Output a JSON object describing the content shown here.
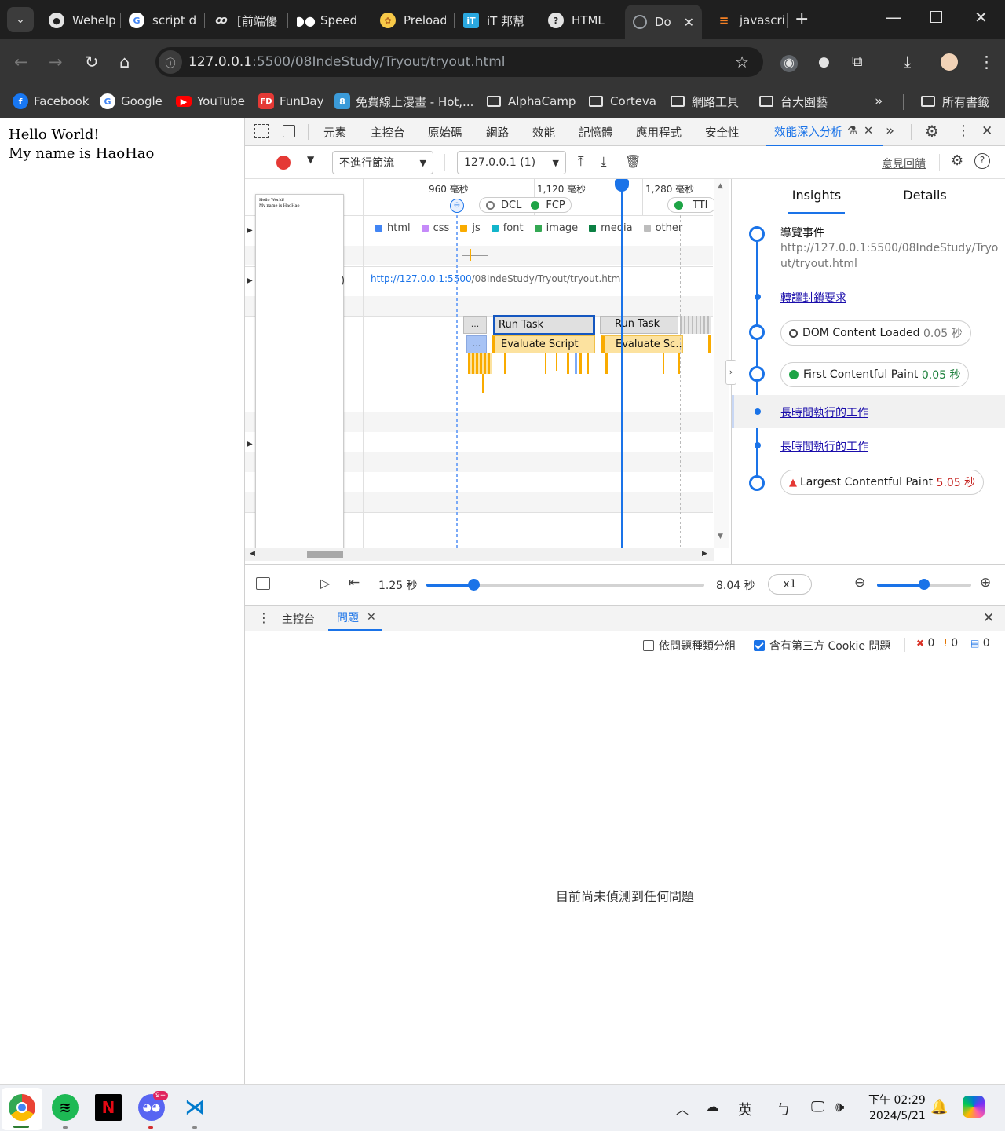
{
  "browser": {
    "tabs": [
      {
        "title": "Wehelp",
        "icon": "github-icon"
      },
      {
        "title": "script d",
        "icon": "google-icon"
      },
      {
        "title": "[前端優",
        "icon": "link-icon"
      },
      {
        "title": "Speed",
        "icon": "medium-icon"
      },
      {
        "title": "Preload",
        "icon": "preload-icon"
      },
      {
        "title": "iT 邦幫",
        "icon": "ithome-icon"
      },
      {
        "title": "HTML",
        "icon": "help-icon"
      },
      {
        "title": "Do",
        "icon": "globe-icon",
        "active": true
      },
      {
        "title": "javascri",
        "icon": "stackoverflow-icon"
      }
    ],
    "url_host": "127.0.0.1",
    "url_path": ":5500/08IndeStudy/Tryout/tryout.html",
    "bookmarks": [
      "Facebook",
      "Google",
      "YouTube",
      "FunDay",
      "免費線上漫畫 - Hot,...",
      "AlphaCamp",
      "Corteva",
      "網路工具",
      "台大園藝"
    ],
    "all_bookmarks": "所有書籤"
  },
  "page": {
    "line1": "Hello World!",
    "line2": "My name is HaoHao"
  },
  "devtools": {
    "tabs": [
      "元素",
      "主控台",
      "原始碼",
      "網路",
      "效能",
      "記憶體",
      "應用程式",
      "安全性"
    ],
    "active_tab": "效能深入分析",
    "throttle": "不進行節流",
    "recording": "127.0.0.1 (1)",
    "feedback": "意見回饋",
    "timeline": {
      "ruler": [
        "960 毫秒",
        "1,120 毫秒",
        "1,280 毫秒"
      ],
      "markers": {
        "dcl": "DCL",
        "fcp": "FCP",
        "tti": "TTI"
      },
      "legend": [
        {
          "name": "html",
          "color": "#4285f4"
        },
        {
          "name": "css",
          "color": "#c58af9"
        },
        {
          "name": "js",
          "color": "#f9ab00"
        },
        {
          "name": "font",
          "color": "#12b5cb"
        },
        {
          "name": "image",
          "color": "#34a853"
        },
        {
          "name": "media",
          "color": "#0b8043"
        },
        {
          "name": "other",
          "color": "#bdbdbd"
        }
      ],
      "request_url_host": "http://127.0.0.1:5500",
      "request_url_path": "/08IndeStudy/Tryout/tryout.html",
      "thumb_line1": "Hello World!",
      "thumb_line2": "My name is HaoHao",
      "paren": ")",
      "ellipsis": "...",
      "run_task": "Run Task",
      "evaluate_script": "Evaluate Script",
      "evaluate_script_short": "Evaluate Sc..."
    },
    "insights": {
      "tab_insights": "Insights",
      "tab_details": "Details",
      "nav_title": "導覽事件",
      "nav_url": "http://127.0.0.1:5500/08IndeStudy/Tryout/tryout.html",
      "redirect": "轉譯封鎖要求",
      "dcl_label": "DOM Content Loaded",
      "dcl_value": "0.05 秒",
      "fcp_label": "First Contentful Paint",
      "fcp_value": "0.05 秒",
      "long_task_1": "長時間執行的工作",
      "long_task_2": "長時間執行的工作",
      "lcp_label": "Largest Contentful Paint",
      "lcp_value": "5.05 秒"
    },
    "playback": {
      "current": "1.25 秒",
      "total": "8.04 秒",
      "speed": "x1",
      "position_fraction": 0.17,
      "zoom_fraction": 0.5
    },
    "drawer": {
      "tabs": [
        "主控台",
        "問題"
      ],
      "active": "問題",
      "group_by_kind": "依問題種類分組",
      "include_third_party": "含有第三方 Cookie 問題",
      "errors": "0",
      "warnings": "0",
      "infos": "0",
      "empty": "目前尚未偵測到任何問題"
    }
  },
  "taskbar": {
    "time": "下午 02:29",
    "date": "2024/5/21",
    "ime": "英",
    "ime2": "ㄅ",
    "discord_badge": "9+"
  }
}
